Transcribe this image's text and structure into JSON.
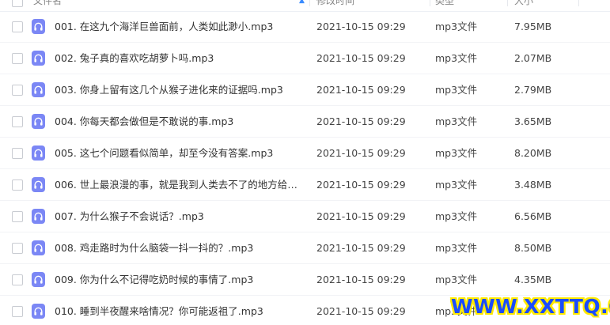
{
  "header": {
    "columns": [
      {
        "label": "文件名"
      },
      {
        "label": "修改时间"
      },
      {
        "label": "类型"
      },
      {
        "label": "大小"
      }
    ]
  },
  "files": [
    {
      "name": "001. 在这九个海洋巨兽面前，人类如此渺小.mp3",
      "date": "2021-10-15 09:29",
      "type": "mp3文件",
      "size": "7.95MB",
      "icon": "audio-file-icon"
    },
    {
      "name": "002. 兔子真的喜欢吃胡萝卜吗.mp3",
      "date": "2021-10-15 09:29",
      "type": "mp3文件",
      "size": "2.07MB",
      "icon": "audio-file-icon"
    },
    {
      "name": "003. 你身上留有这几个从猴子进化来的证据吗.mp3",
      "date": "2021-10-15 09:29",
      "type": "mp3文件",
      "size": "2.79MB",
      "icon": "audio-file-icon"
    },
    {
      "name": "004. 你每天都会做但是不敢说的事.mp3",
      "date": "2021-10-15 09:29",
      "type": "mp3文件",
      "size": "3.65MB",
      "icon": "audio-file-icon"
    },
    {
      "name": "005. 这七个问题看似简单，却至今没有答案.mp3",
      "date": "2021-10-15 09:29",
      "type": "mp3文件",
      "size": "8.20MB",
      "icon": "audio-file-icon"
    },
    {
      "name": "006. 世上最浪漫的事，就是我到人类去不了的地方给爸爸...",
      "date": "2021-10-15 09:29",
      "type": "mp3文件",
      "size": "3.48MB",
      "icon": "audio-file-icon"
    },
    {
      "name": "007. 为什么猴子不会说话？.mp3",
      "date": "2021-10-15 09:29",
      "type": "mp3文件",
      "size": "6.56MB",
      "icon": "audio-file-icon"
    },
    {
      "name": "008. 鸡走路时为什么脑袋一抖一抖的？.mp3",
      "date": "2021-10-15 09:29",
      "type": "mp3文件",
      "size": "8.50MB",
      "icon": "audio-file-icon"
    },
    {
      "name": "009. 你为什么不记得吃奶时候的事情了.mp3",
      "date": "2021-10-15 09:29",
      "type": "mp3文件",
      "size": "4.35MB",
      "icon": "audio-file-icon"
    },
    {
      "name": "010. 睡到半夜醒来啥情况？你可能返祖了.mp3",
      "date": "2021-10-15 09:29",
      "type": "mp3文件",
      "size": "",
      "icon": "audio-file-icon"
    }
  ],
  "watermark": "WWW.XXTTQ.COM",
  "colors": {
    "file_icon": "#7b87f5",
    "watermark_text": "#1a4cff",
    "watermark_outline": "#ffea00"
  }
}
